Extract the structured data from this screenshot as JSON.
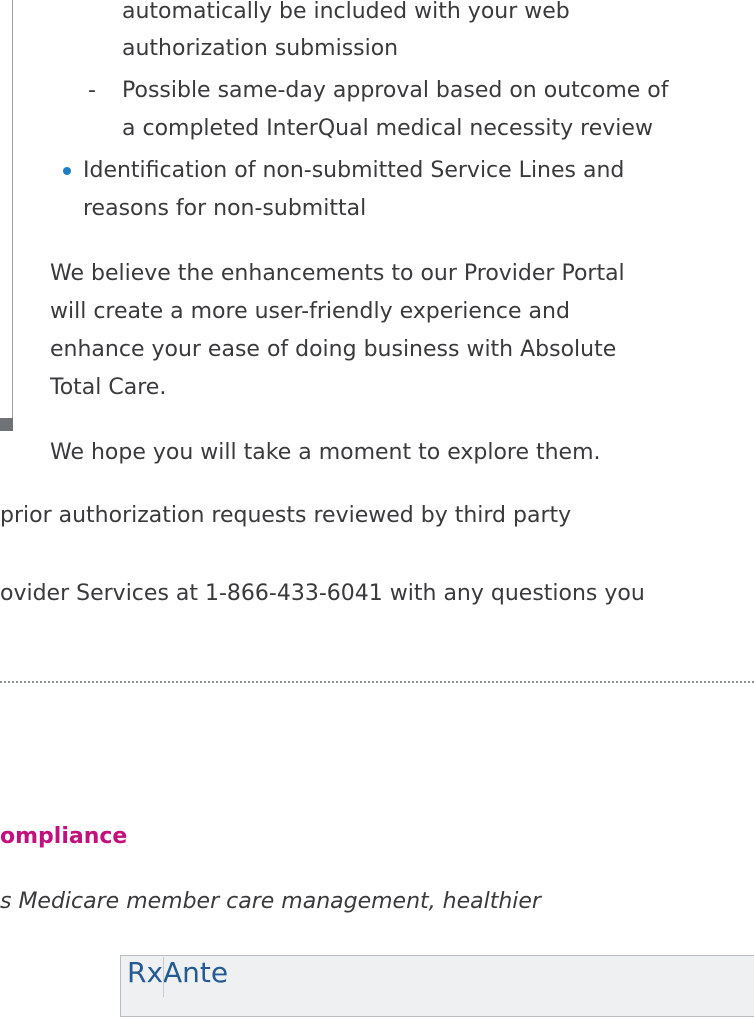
{
  "article": {
    "bullet_continuation_1": "automatically be included with your web",
    "bullet_continuation_2": "authorization submission",
    "sub_dash": "-",
    "sub_item_line_1": "Possible same-day approval based on outcome of",
    "sub_item_line_2": "a completed InterQual medical necessity review",
    "bullet_2_line_1": "Identification of non-submitted Service Lines and",
    "bullet_2_line_2": "reasons for non-submittal",
    "para_1_line_1": "We believe the enhancements to our Provider Portal",
    "para_1_line_2": "will create a more user-friendly experience and",
    "para_1_line_3": "enhance your ease of doing business with Absolute",
    "para_1_line_4": "Total Care.",
    "para_2": "We hope you will take a moment to explore them."
  },
  "lower": {
    "line_1": "prior authorization requests reviewed by third party",
    "line_2": "ovider Services at 1-866-433-6041 with any questions you"
  },
  "section": {
    "heading": "ompliance",
    "intro_italic": "s Medicare member care management, healthier"
  },
  "figure": {
    "logo_text": "RxAnte"
  },
  "colors": {
    "heading": "#c2117c",
    "bullet": "#1f7fc4",
    "body_text": "#3a3a3c"
  }
}
